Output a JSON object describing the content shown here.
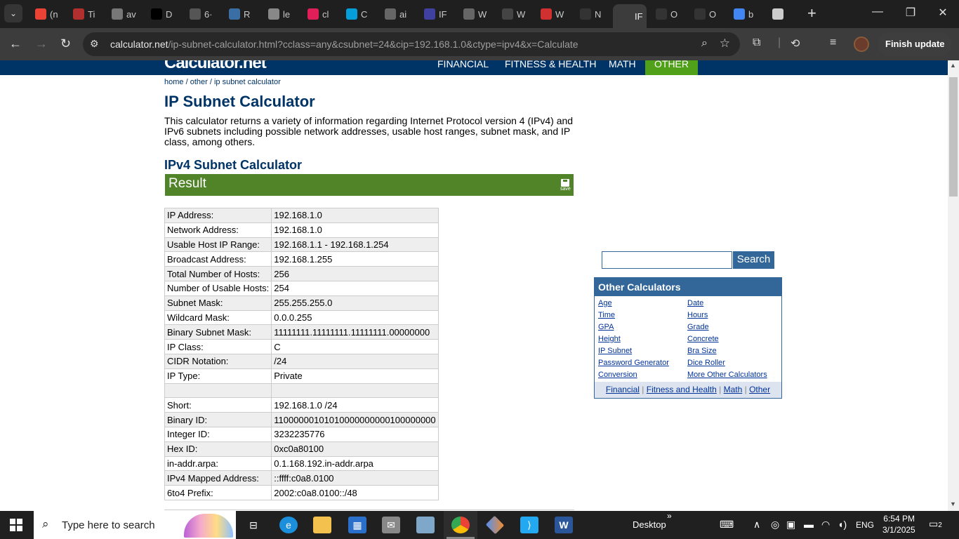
{
  "browser": {
    "tabs": [
      {
        "label": "(n",
        "color": "#ea4335"
      },
      {
        "label": "Ti",
        "color": "#b03030"
      },
      {
        "label": "av",
        "color": "#777777"
      },
      {
        "label": "D",
        "color": "#000000"
      },
      {
        "label": "6·",
        "color": "#555555"
      },
      {
        "label": "R",
        "color": "#3a6ea5"
      },
      {
        "label": "le",
        "color": "#888888"
      },
      {
        "label": "cl",
        "color": "#e01e5a"
      },
      {
        "label": "C",
        "color": "#049fd9"
      },
      {
        "label": "ai",
        "color": "#666666"
      },
      {
        "label": "IF",
        "color": "#4040a0"
      },
      {
        "label": "W",
        "color": "#666666"
      },
      {
        "label": "W",
        "color": "#444444"
      },
      {
        "label": "W",
        "color": "#d03030"
      },
      {
        "label": "N",
        "color": "#333333"
      },
      {
        "label": "IF",
        "color": "#3c3c3c"
      },
      {
        "label": "O",
        "color": "#333333"
      },
      {
        "label": "O",
        "color": "#333333"
      },
      {
        "label": "b",
        "color": "#4285f4"
      },
      {
        "label": "",
        "color": "#cccccc"
      }
    ],
    "url_host": "calculator.net",
    "url_path": "/ip-subnet-calculator.html?cclass=any&csubnet=24&cip=192.168.1.0&ctype=ipv4&x=Calculate",
    "finish_update": "Finish update"
  },
  "page": {
    "nav": {
      "financial": "FINANCIAL",
      "fitness": "FITNESS & HEALTH",
      "math": "MATH",
      "other": "OTHER"
    },
    "logo_text": "Calculator.net",
    "breadcrumb": {
      "home": "home",
      "sep1": " / ",
      "other": "other",
      "sep2": " / ",
      "current": "ip subnet calculator"
    },
    "title": "IP Subnet Calculator",
    "intro": "This calculator returns a variety of information regarding Internet Protocol version 4 (IPv4) and IPv6 subnets including possible network addresses, usable host ranges, subnet mask, and IP class, among others.",
    "section_title": "IPv4 Subnet Calculator",
    "result_label": "Result",
    "save_label": "save",
    "results": [
      [
        "IP Address:",
        "192.168.1.0"
      ],
      [
        "Network Address:",
        "192.168.1.0"
      ],
      [
        "Usable Host IP Range:",
        "192.168.1.1 - 192.168.1.254"
      ],
      [
        "Broadcast Address:",
        "192.168.1.255"
      ],
      [
        "Total Number of Hosts:",
        "256"
      ],
      [
        "Number of Usable Hosts:",
        "254"
      ],
      [
        "Subnet Mask:",
        "255.255.255.0"
      ],
      [
        "Wildcard Mask:",
        "0.0.0.255"
      ],
      [
        "Binary Subnet Mask:",
        "11111111.11111111.11111111.00000000"
      ],
      [
        "IP Class:",
        "C"
      ],
      [
        "CIDR Notation:",
        "/24"
      ],
      [
        "IP Type:",
        "Private"
      ],
      [
        "",
        ""
      ],
      [
        "Short:",
        "192.168.1.0 /24"
      ],
      [
        "Binary ID:",
        "11000000101010000000000100000000"
      ],
      [
        "Integer ID:",
        "3232235776"
      ],
      [
        "Hex ID:",
        "0xc0a80100"
      ],
      [
        "in-addr.arpa:",
        "0.1.168.192.in-addr.arpa"
      ],
      [
        "IPv4 Mapped Address:",
        "::ffff:c0a8.0100"
      ],
      [
        "6to4 Prefix:",
        "2002:c0a8.0100::/48"
      ]
    ],
    "search_button": "Search",
    "search_value": "",
    "other_calculators": {
      "title": "Other Calculators",
      "left": [
        "Age",
        "Time",
        "GPA",
        "Height",
        "IP Subnet",
        "Password Generator",
        "Conversion"
      ],
      "right": [
        "Date",
        "Hours",
        "Grade",
        "Concrete",
        "Bra Size",
        "Dice Roller",
        "More Other Calculators"
      ],
      "footer": [
        "Financial",
        "Fitness and Health",
        "Math",
        "Other"
      ],
      "footer_sep": " | "
    }
  },
  "taskbar": {
    "search_placeholder": "Type here to search",
    "desktop_label": "Desktop",
    "language": "ENG",
    "time": "6:54 PM",
    "date": "3/1/2025",
    "notification_count": "2"
  }
}
